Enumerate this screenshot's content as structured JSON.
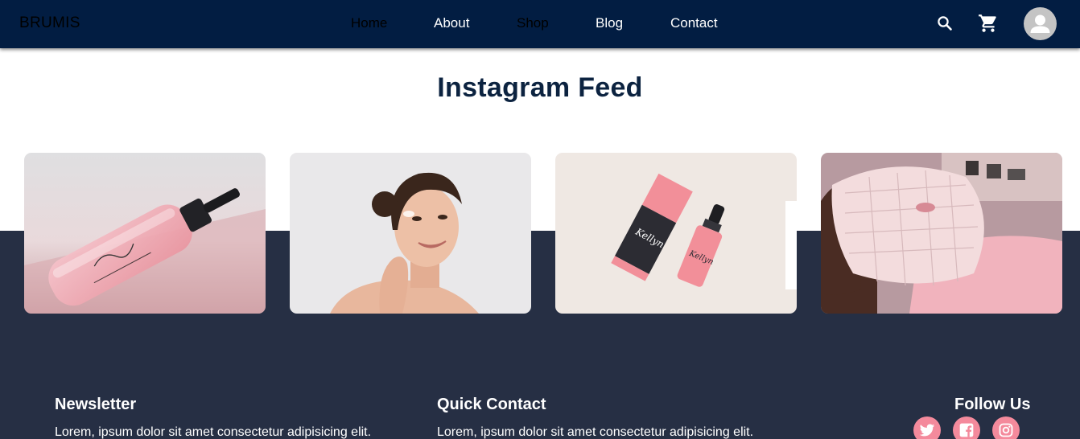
{
  "nav": {
    "brand": "BRUMIS",
    "links": [
      {
        "label": "Home"
      },
      {
        "label": "About"
      },
      {
        "label": "Shop"
      },
      {
        "label": "Blog"
      },
      {
        "label": "Contact"
      }
    ],
    "icons": [
      "search-icon",
      "cart-icon",
      "avatar-icon"
    ]
  },
  "instagram": {
    "title": "Instagram Feed",
    "posts": [
      {
        "subject": "pink-cleanser-pump-bottle"
      },
      {
        "subject": "smiling-woman-applying-cream"
      },
      {
        "subject": "kellyn-serum-box-and-dropper"
      },
      {
        "subject": "rose-quartz-face-mask"
      }
    ]
  },
  "footer": {
    "newsletter": {
      "title": "Newsletter",
      "text": "Lorem, ipsum dolor sit amet consectetur adipisicing elit."
    },
    "quick_contact": {
      "title": "Quick Contact",
      "text": "Lorem, ipsum dolor sit amet consectetur adipisicing elit."
    },
    "follow": {
      "title": "Follow Us",
      "icons": [
        "twitter-icon",
        "facebook-icon",
        "instagram-icon"
      ]
    }
  },
  "colors": {
    "navbar_bg": "#021d42",
    "heading": "#0c2340",
    "footer_bg": "#262f44",
    "social_accent": "#f48a9c"
  }
}
